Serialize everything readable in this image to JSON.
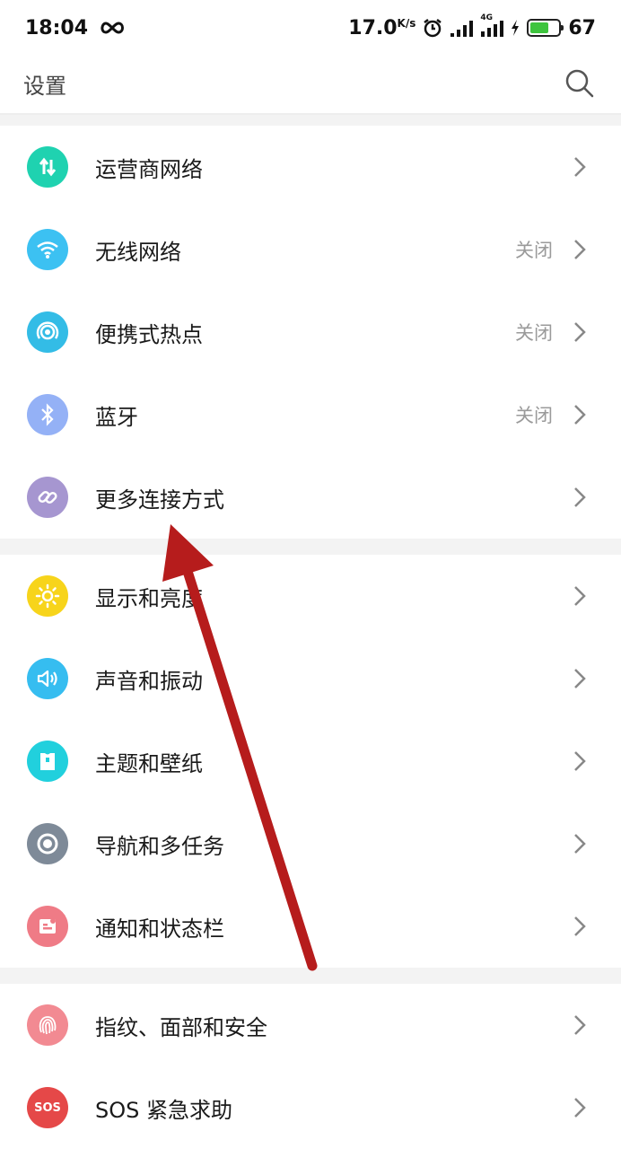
{
  "status_bar": {
    "time": "18:04",
    "speed": "17.0",
    "speed_unit": "K/s",
    "network_badge": "4G",
    "battery": "67"
  },
  "header": {
    "title": "设置"
  },
  "groups": [
    {
      "items": [
        {
          "label": "运营商网络",
          "value": "",
          "icon": "mobile-data-icon",
          "color": "#1fd2b0"
        },
        {
          "label": "无线网络",
          "value": "关闭",
          "icon": "wifi-icon",
          "color": "#3cc1f2"
        },
        {
          "label": "便携式热点",
          "value": "关闭",
          "icon": "hotspot-icon",
          "color": "#33bce6"
        },
        {
          "label": "蓝牙",
          "value": "关闭",
          "icon": "bluetooth-icon",
          "color": "#94b1f6"
        },
        {
          "label": "更多连接方式",
          "value": "",
          "icon": "link-icon",
          "color": "#a696d0"
        }
      ]
    },
    {
      "items": [
        {
          "label": "显示和亮度",
          "value": "",
          "icon": "sun-icon",
          "color": "#f7d41b"
        },
        {
          "label": "声音和振动",
          "value": "",
          "icon": "speaker-icon",
          "color": "#36bdf0"
        },
        {
          "label": "主题和壁纸",
          "value": "",
          "icon": "shirt-icon",
          "color": "#21d0dd"
        },
        {
          "label": "导航和多任务",
          "value": "",
          "icon": "navigation-icon",
          "color": "#7e8a98"
        },
        {
          "label": "通知和状态栏",
          "value": "",
          "icon": "notification-icon",
          "color": "#ef7b86"
        }
      ]
    },
    {
      "items": [
        {
          "label": "指纹、面部和安全",
          "value": "",
          "icon": "fingerprint-icon",
          "color": "#f28a92"
        },
        {
          "label": "SOS 紧急求助",
          "value": "",
          "icon": "sos-icon",
          "color": "#e54848",
          "icon_text": "SOS"
        }
      ]
    }
  ]
}
